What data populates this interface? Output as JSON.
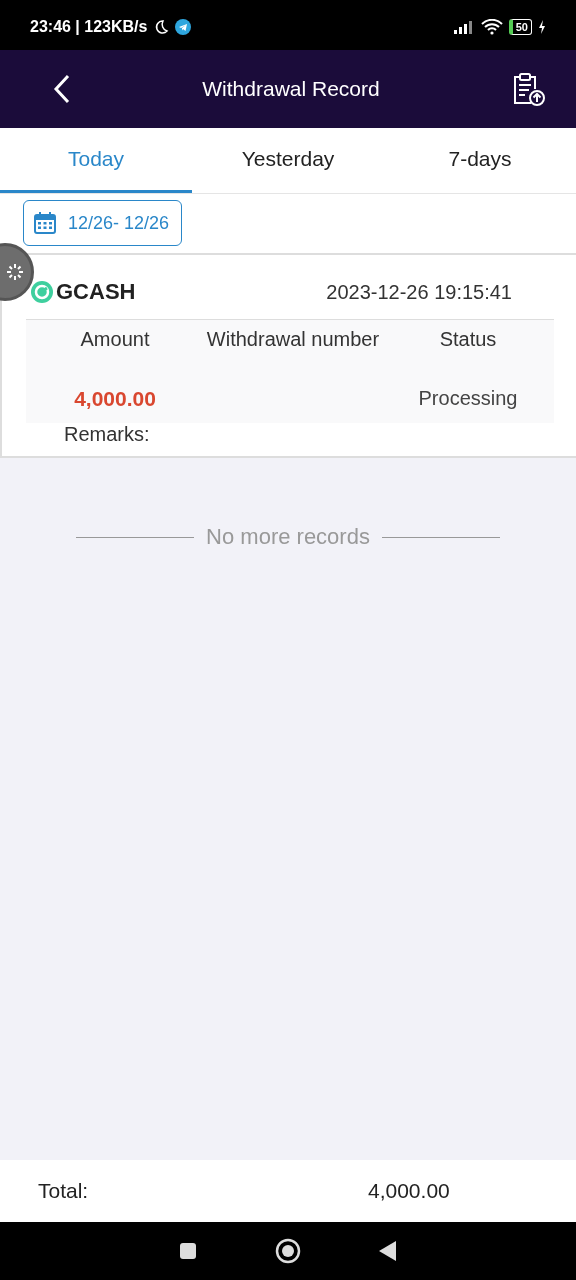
{
  "status_bar": {
    "time": "23:46 | 123KB/s",
    "battery": "50"
  },
  "header": {
    "title": "Withdrawal Record"
  },
  "tabs": [
    {
      "label": "Today",
      "selected": true
    },
    {
      "label": "Yesterday",
      "selected": false
    },
    {
      "label": "7-days",
      "selected": false
    }
  ],
  "date_range": "12/26- 12/26",
  "record": {
    "method": "GCASH",
    "datetime": "2023-12-26 19:15:41",
    "columns": [
      "Amount",
      "Withdrawal number",
      "Status"
    ],
    "amount": "4,000.00",
    "status": "Processing",
    "remarks_label": "Remarks:"
  },
  "end_text": "No more records",
  "total": {
    "label": "Total:",
    "value": "4,000.00"
  }
}
